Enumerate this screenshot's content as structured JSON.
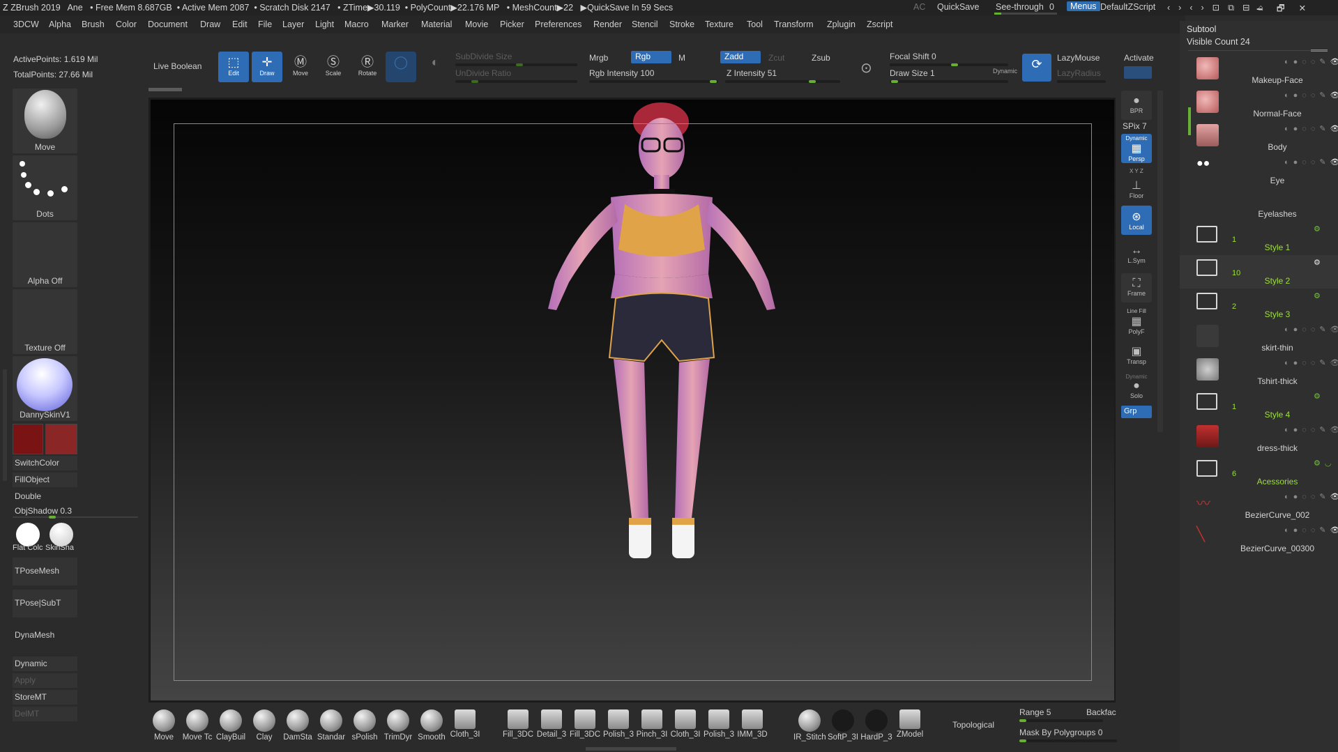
{
  "titlebar": {
    "app": "ZBrush 2019",
    "user": "Ane",
    "free_mem": "• Free Mem 8.687GB",
    "active_mem": "• Active Mem 2087",
    "scratch": "• Scratch Disk 2147",
    "ztime": "• ZTime▶30.119",
    "polycount": "• PolyCount▶22.176 MP",
    "meshcount": "• MeshCount▶22",
    "quicksave_timer": "▶QuickSave In 59 Secs",
    "ac": "AC",
    "quicksave": "QuickSave",
    "see_through": "See-through",
    "see_through_value": "0",
    "menus": "Menus",
    "script": "DefaultZScript"
  },
  "menu": [
    "3DCW",
    "Alpha",
    "Brush",
    "Color",
    "Document",
    "Draw",
    "Edit",
    "File",
    "Layer",
    "Light",
    "Macro",
    "Marker",
    "Material",
    "Movie",
    "Picker",
    "Preferences",
    "Render",
    "Stencil",
    "Stroke",
    "Texture",
    "Tool",
    "Transform",
    "Zplugin",
    "Zscript"
  ],
  "toolbar": {
    "active_points": "ActivePoints: 1.619 Mil",
    "total_points": "TotalPoints: 27.66 Mil",
    "live_boolean": "Live Boolean",
    "edit": "Edit",
    "draw": "Draw",
    "move": "Move",
    "scale": "Scale",
    "rotate": "Rotate",
    "subdivide_size": "SubDivide Size",
    "undivide_ratio": "UnDivide Ratio",
    "mrgb": "Mrgb",
    "rgb": "Rgb",
    "m": "M",
    "rgb_intensity": "Rgb Intensity 100",
    "zadd": "Zadd",
    "zcut": "Zcut",
    "zsub": "Zsub",
    "z_intensity": "Z Intensity 51",
    "focal_shift": "Focal Shift 0",
    "draw_size": "Draw Size 1",
    "dynamic": "Dynamic",
    "lazymouse": "LazyMouse",
    "lazyradius": "LazyRadius",
    "activate": "Activate"
  },
  "lefttray": {
    "brush": "Move",
    "stroke": "Dots",
    "alpha": "Alpha Off",
    "texture": "Texture Off",
    "material": "DannySkinV1",
    "switchcolor": "SwitchColor",
    "fillobject": "FillObject",
    "double": "Double",
    "objshadow": "ObjShadow 0.3",
    "flat_color": "Flat Colc",
    "skinshade": "SkinSha",
    "tposemesh": "TPoseMesh",
    "tpose_subt": "TPose|SubT",
    "dynamesh": "DynaMesh",
    "dynamic": "Dynamic",
    "apply": "Apply",
    "storemt": "StoreMT",
    "delmt": "DelMT",
    "main_color": "#7a1414",
    "secondary_color": "#8a2626"
  },
  "rightshelf": {
    "bpr": "BPR",
    "spix": "SPix 7",
    "dynamic": "Dynamic",
    "persp": "Persp",
    "xyz": "X Y Z",
    "floor": "Floor",
    "local": "Local",
    "lsym": "L.Sym",
    "frame": "Frame",
    "linefill": "Line Fill",
    "polyf": "PolyF",
    "transp": "Transp",
    "dynamic2": "Dynamic",
    "solo": "Solo",
    "grp": "Grp"
  },
  "subtool": {
    "title": "Subtool",
    "visible_count": "Visible Count 24",
    "items": [
      {
        "name": "Makeup-Face",
        "type": "mesh"
      },
      {
        "name": "Normal-Face",
        "type": "mesh"
      },
      {
        "name": "Body",
        "type": "mesh"
      },
      {
        "name": "Eye",
        "type": "mesh"
      },
      {
        "name": "Eyelashes",
        "type": "mesh"
      },
      {
        "name": "Style 1",
        "type": "folder",
        "count": "1"
      },
      {
        "name": "Style 2",
        "type": "folder",
        "count": "10"
      },
      {
        "name": "Style 3",
        "type": "folder",
        "count": "2"
      },
      {
        "name": "skirt-thin",
        "type": "mesh"
      },
      {
        "name": "Tshirt-thick",
        "type": "mesh"
      },
      {
        "name": "Style 4",
        "type": "folder",
        "count": "1"
      },
      {
        "name": "dress-thick",
        "type": "mesh"
      },
      {
        "name": "Acessories",
        "type": "folder",
        "count": "6"
      },
      {
        "name": "BezierCurve_002",
        "type": "mesh"
      },
      {
        "name": "BezierCurve_00300",
        "type": "mesh"
      }
    ]
  },
  "bottom": {
    "brushes": [
      "Move",
      "Move Tc",
      "ClayBuil",
      "Clay",
      "DamSta",
      "Standar",
      "sPolish",
      "TrimDyr",
      "Smooth",
      "Cloth_3I",
      "Fill_3DC",
      "Detail_3",
      "Fill_3DC",
      "Polish_3",
      "Pinch_3I",
      "Cloth_3I",
      "Polish_3",
      "IMM_3D",
      "IR_Stitch",
      "SoftP_3I",
      "HardP_3",
      "ZModel"
    ],
    "topological": "Topological",
    "range": "Range 5",
    "backface": "Backfac",
    "mask_by_polygroups": "Mask By Polygroups 0"
  }
}
